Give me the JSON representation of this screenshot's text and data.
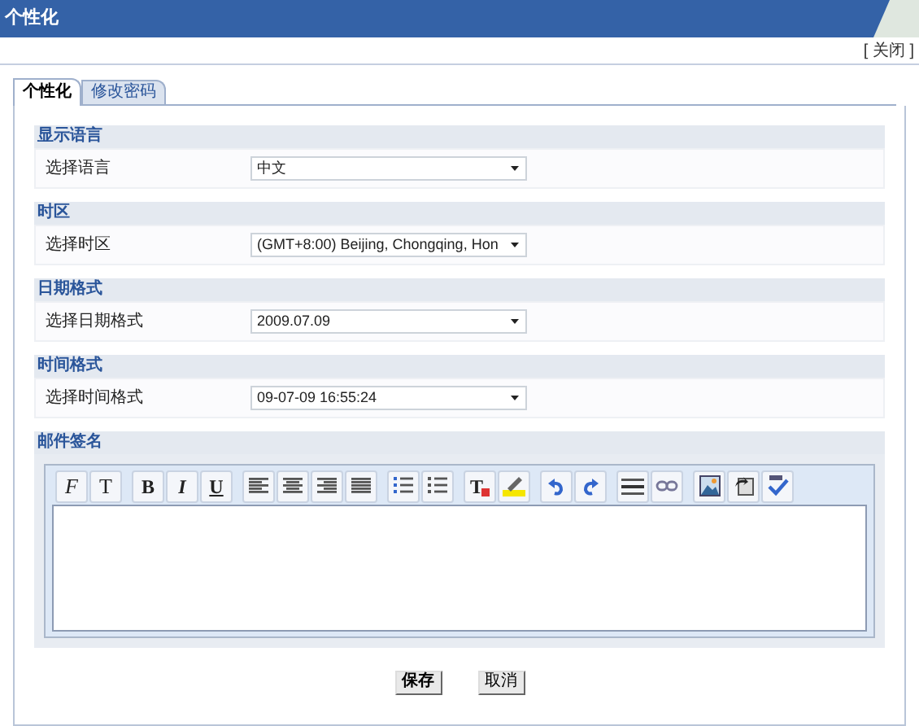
{
  "window": {
    "title": "个性化",
    "close_link": "[ 关闭 ]"
  },
  "tabs": [
    {
      "label": "个性化",
      "selected": true
    },
    {
      "label": "修改密码",
      "selected": false
    }
  ],
  "sections": [
    {
      "title": "显示语言",
      "label": "选择语言",
      "value": "中文"
    },
    {
      "title": "时区",
      "label": "选择时区",
      "value": "(GMT+8:00) Beijing, Chongqing, Hon"
    },
    {
      "title": "日期格式",
      "label": "选择日期格式",
      "value": "2009.07.09"
    },
    {
      "title": "时间格式",
      "label": "选择时间格式",
      "value": "09-07-09 16:55:24"
    }
  ],
  "signature": {
    "title": "邮件签名",
    "toolbar": [
      [
        {
          "kind": "font",
          "glyph": "F"
        },
        {
          "kind": "size",
          "glyph": "T"
        }
      ],
      [
        {
          "kind": "bold",
          "glyph": "B"
        },
        {
          "kind": "italic",
          "glyph": "I"
        },
        {
          "kind": "underline",
          "glyph": "U"
        }
      ],
      [
        {
          "kind": "align-left"
        },
        {
          "kind": "align-center"
        },
        {
          "kind": "align-right"
        },
        {
          "kind": "justify"
        }
      ],
      [
        {
          "kind": "numbered-list"
        },
        {
          "kind": "bullet-list"
        }
      ],
      [
        {
          "kind": "text-color",
          "glyph": "T"
        },
        {
          "kind": "highlight"
        }
      ],
      [
        {
          "kind": "undo"
        },
        {
          "kind": "redo"
        }
      ],
      [
        {
          "kind": "rule"
        },
        {
          "kind": "link"
        }
      ],
      [
        {
          "kind": "image"
        },
        {
          "kind": "paste"
        },
        {
          "kind": "spellcheck"
        }
      ]
    ]
  },
  "buttons": [
    "保存",
    "取消"
  ]
}
